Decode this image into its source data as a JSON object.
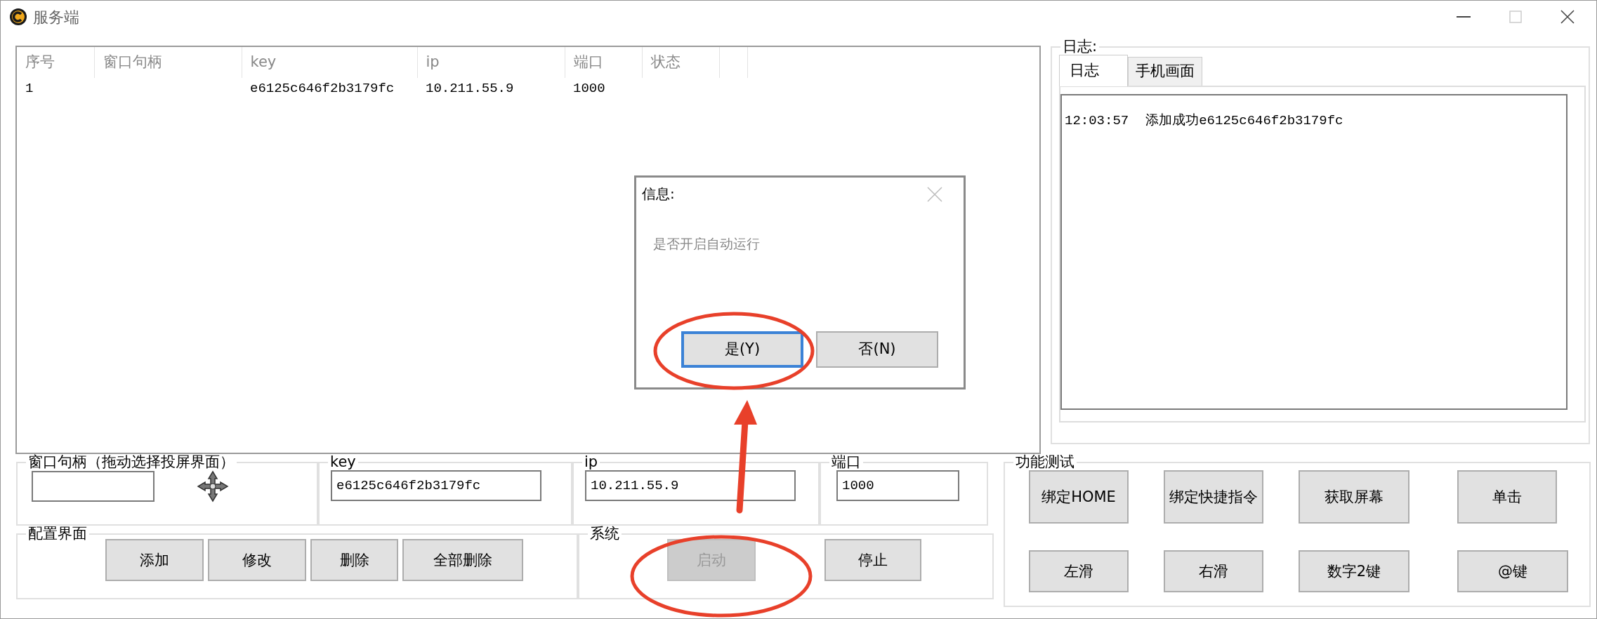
{
  "window": {
    "title": "服务端"
  },
  "table": {
    "columns": [
      "序号",
      "窗口句柄",
      "key",
      "ip",
      "端口",
      "状态"
    ],
    "rows": [
      {
        "number": "1",
        "key": "e6125c646f2b3179fc",
        "ip": "10.211.55.9",
        "port": "1000"
      }
    ]
  },
  "log": {
    "title": "日志:",
    "tabs": [
      {
        "label": "日志",
        "selected": true
      },
      {
        "label": "手机画面",
        "selected": false
      }
    ],
    "entries": [
      {
        "time": "12:03:57",
        "message": "添加成功e6125c646f2b3179fc"
      }
    ]
  },
  "fields": [
    {
      "label": "窗口句柄（拖动选择投屏界面）",
      "kind": "handle"
    },
    {
      "label": "key",
      "value": "e6125c646f2b3179fc",
      "kind": "text"
    },
    {
      "label": "ip",
      "value": "10.211.55.9",
      "kind": "text"
    },
    {
      "label": "端口",
      "value": "1000",
      "kind": "small"
    }
  ],
  "config": {
    "label": "配置界面",
    "buttons": [
      {
        "label": "添加",
        "disabled": false
      },
      {
        "label": "修改",
        "disabled": false
      },
      {
        "label": "删除",
        "disabled": false
      },
      {
        "label": "全部删除",
        "disabled": false
      }
    ]
  },
  "system": {
    "label": "系统",
    "buttons": [
      {
        "label": "启动",
        "disabled": true
      },
      {
        "label": "停止",
        "disabled": false
      }
    ]
  },
  "test": {
    "label": "功能测试",
    "buttons": [
      {
        "label": "绑定HOME"
      },
      {
        "label": "绑定快捷指令"
      },
      {
        "label": "获取屏幕"
      },
      {
        "label": "单击"
      },
      {
        "label": "左滑"
      },
      {
        "label": "右滑"
      },
      {
        "label": "数字2键"
      },
      {
        "label": "@键"
      }
    ]
  },
  "dialog": {
    "title": "信息:",
    "message": "是否开启自动运行",
    "buttons": [
      {
        "label": "是(Y)",
        "focused": true
      },
      {
        "label": "否(N)",
        "focused": false
      }
    ]
  },
  "annotations": [
    {
      "kind": "ellipse"
    },
    {
      "kind": "ellipse"
    },
    {
      "kind": "arrow"
    }
  ]
}
